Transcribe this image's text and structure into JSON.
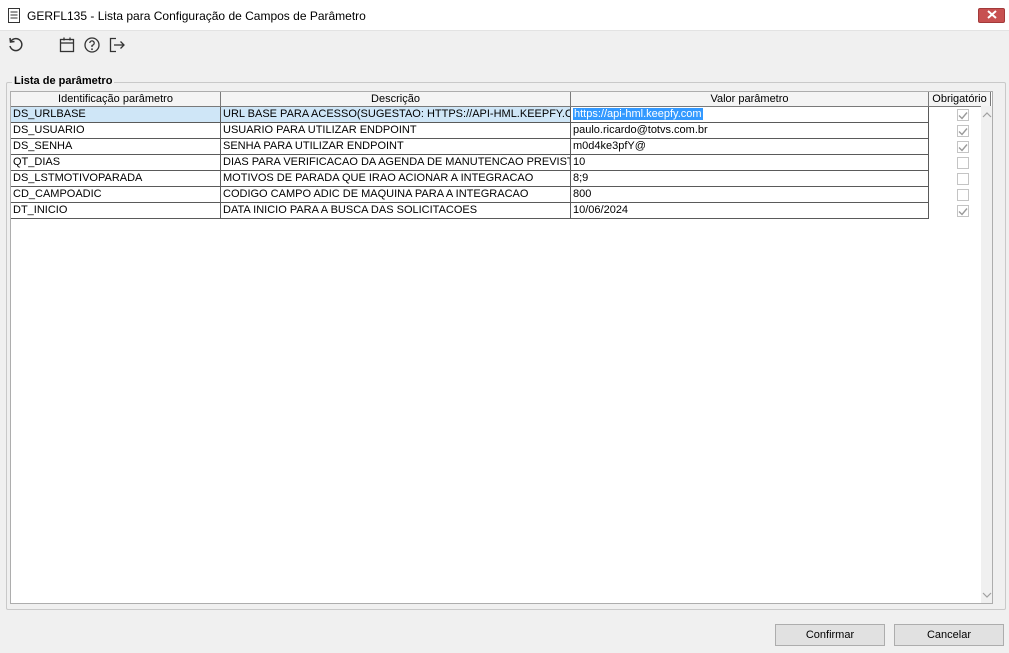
{
  "window": {
    "title": "GERFL135 - Lista para Configuração de Campos de Parâmetro",
    "close_icon": "close-icon"
  },
  "toolbar": {
    "icons": [
      "refresh-icon",
      "calendar-icon",
      "help-icon",
      "exit-icon"
    ]
  },
  "group": {
    "legend": "Lista de parâmetro"
  },
  "table": {
    "columns": [
      "Identificação parâmetro",
      "Descrição",
      "Valor parâmetro",
      "Obrigatório"
    ],
    "rows": [
      {
        "id": "DS_URLBASE",
        "descricao": "URL BASE PARA ACESSO(SUGESTAO: HTTPS://API-HML.KEEPFY.COM/\\",
        "valor": "https://api-hml.keepfy.com",
        "obrigatorio": true,
        "selected": true
      },
      {
        "id": "DS_USUARIO",
        "descricao": "USUARIO PARA UTILIZAR ENDPOINT",
        "valor": "paulo.ricardo@totvs.com.br",
        "obrigatorio": true,
        "selected": false
      },
      {
        "id": "DS_SENHA",
        "descricao": "SENHA PARA UTILIZAR ENDPOINT",
        "valor": "m0d4ke3pfY@",
        "obrigatorio": true,
        "selected": false
      },
      {
        "id": "QT_DIAS",
        "descricao": "DIAS PARA VERIFICACAO DA AGENDA DE MANUTENCAO PREVISTA",
        "valor": "10",
        "obrigatorio": false,
        "selected": false
      },
      {
        "id": "DS_LSTMOTIVOPARADA",
        "descricao": "MOTIVOS DE PARADA QUE IRAO ACIONAR A INTEGRACAO",
        "valor": "8;9",
        "obrigatorio": false,
        "selected": false
      },
      {
        "id": "CD_CAMPOADIC",
        "descricao": "CODIGO CAMPO ADIC DE MAQUINA PARA A INTEGRACAO",
        "valor": "800",
        "obrigatorio": false,
        "selected": false
      },
      {
        "id": "DT_INICIO",
        "descricao": "DATA INICIO PARA A BUSCA DAS SOLICITACOES",
        "valor": "10/06/2024",
        "obrigatorio": true,
        "selected": false
      }
    ]
  },
  "buttons": {
    "confirm": "Confirmar",
    "cancel": "Cancelar"
  },
  "colors": {
    "selection": "#3399ff",
    "row_selected": "#cfe6f7",
    "close_button": "#c75050"
  }
}
